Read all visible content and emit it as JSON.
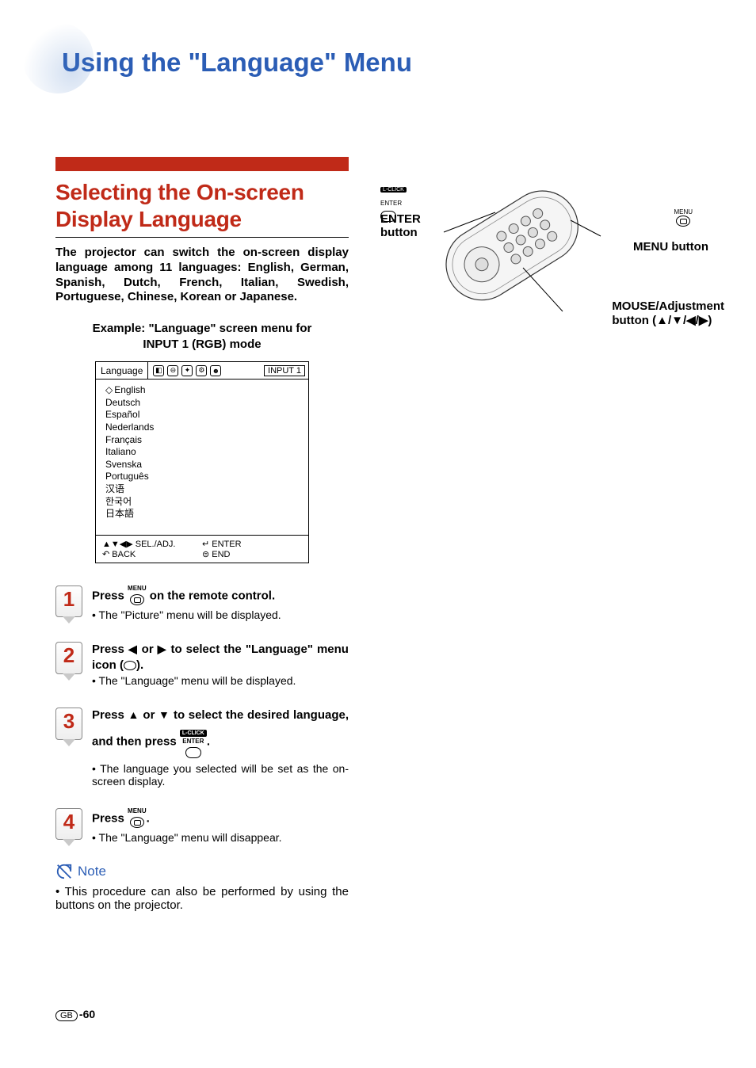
{
  "page_title": "Using the \"Language\" Menu",
  "section_title_l1": "Selecting the On-screen",
  "section_title_l2": "Display Language",
  "intro": "The projector can switch the on-screen display language among 11 languages: English, German, Spanish, Dutch, French, Italian, Swedish, Portuguese, Chinese, Korean or Japanese.",
  "example_caption_l1": "Example: \"Language\" screen menu for",
  "example_caption_l2": "INPUT 1 (RGB) mode",
  "lang_menu": {
    "header_label": "Language",
    "input_badge": "INPUT 1",
    "items": [
      "English",
      "Deutsch",
      "Español",
      "Nederlands",
      "Français",
      "Italiano",
      "Svenska",
      "Português",
      "汉语",
      "한국어",
      "日本語"
    ],
    "footer_sel": "▲▼◀▶ SEL./ADJ.",
    "footer_enter": "↵ ENTER",
    "footer_back": "↶ BACK",
    "footer_end": "⊜ END"
  },
  "callouts": {
    "enter_l1": "ENTER",
    "enter_l2": "button",
    "menu": "MENU button",
    "mouse_l1": "MOUSE/Adjustment",
    "mouse_l2": "button (▲/▼/◀/▶)",
    "lclick": "L-CLICK",
    "enter_small": "ENTER",
    "menu_small": "MENU"
  },
  "steps": [
    {
      "n": "1",
      "head_pre": "Press ",
      "head_icon_label": "MENU",
      "head_post": " on the remote control.",
      "sub": "• The \"Picture\" menu will be displayed."
    },
    {
      "n": "2",
      "head_pre": "Press ",
      "arr1": "◀",
      "mid": " or ",
      "arr2": "▶",
      "head_post": " to select the \"Language\" menu icon (",
      "head_post2": ").",
      "sub": "• The \"Language\" menu will be displayed."
    },
    {
      "n": "3",
      "head_pre": "Press ",
      "arr1": "▲",
      "mid": " or ",
      "arr2": "▼",
      "head_post": " to select the desired language, and then press ",
      "enter_top": "L-CLICK",
      "enter_mid": "ENTER",
      "head_post2": ".",
      "sub": "• The language you selected will be set as the on-screen display."
    },
    {
      "n": "4",
      "head_pre": "Press ",
      "head_icon_label": "MENU",
      "head_post": ".",
      "sub": "• The \"Language\" menu will disappear."
    }
  ],
  "note_label": "Note",
  "note_text": "• This procedure can also be performed by using the buttons on the projector.",
  "page_footer": {
    "region": "GB",
    "num": "-60"
  }
}
